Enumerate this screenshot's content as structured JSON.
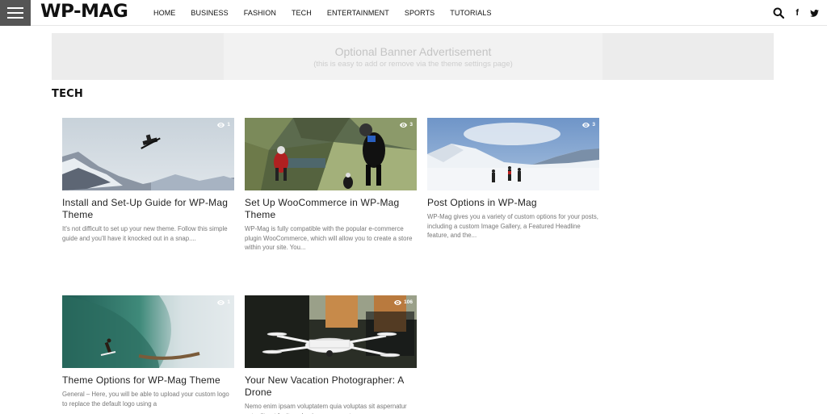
{
  "header": {
    "logo": "WP-MAG",
    "nav": [
      "HOME",
      "BUSINESS",
      "FASHION",
      "TECH",
      "ENTERTAINMENT",
      "SPORTS",
      "TUTORIALS"
    ],
    "icons": [
      "search-icon",
      "facebook-icon",
      "twitter-icon"
    ],
    "facebook_glyph": "f"
  },
  "banner": {
    "title": "Optional Banner Advertisement",
    "subtitle": "(this is easy to add or remove via the theme settings page)"
  },
  "section": {
    "title": "TECH"
  },
  "posts": [
    {
      "title": "Install and Set-Up Guide for WP-Mag Theme",
      "excerpt": "It's not difficult to set up your new theme. Follow this simple guide and you'll have it knocked out in a snap....",
      "views": "1"
    },
    {
      "title": "Set Up WooCommerce in WP-Mag Theme",
      "excerpt": "WP-Mag is fully compatible with the popular e-commerce plugin WooCommerce, which will allow you to create a store within your site. You...",
      "views": "3"
    },
    {
      "title": "Post Options in WP-Mag",
      "excerpt": "WP-Mag gives you a variety of custom options for your posts, including a custom Image Gallery, a Featured Headline feature, and the...",
      "views": "3"
    },
    {
      "title": "Theme Options for WP-Mag Theme",
      "excerpt": "General – Here, you will be able to upload your custom logo to replace the default logo using a",
      "views": "1"
    },
    {
      "title": "Your New Vacation Photographer: A Drone",
      "excerpt": "Nemo enim ipsam voluptatem quia voluptas sit aspernatur aut odit aut fugit, sed quia consequuntur",
      "views": "106"
    }
  ],
  "colors": {
    "menu_button": "#555555",
    "banner_bg": "#ececec",
    "text_dark": "#222222",
    "text_muted": "#777777"
  }
}
